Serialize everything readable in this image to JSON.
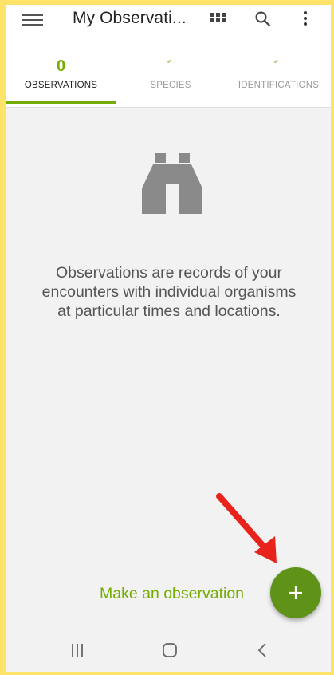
{
  "appbar": {
    "title": "My Observati...",
    "icons": [
      "menu-icon",
      "grid-view-icon",
      "search-icon",
      "more-vert-icon"
    ]
  },
  "tabs": [
    {
      "label": "OBSERVATIONS",
      "count": "0",
      "active": true
    },
    {
      "label": "SPECIES",
      "count": "",
      "active": false
    },
    {
      "label": "IDENTIFICATIONS",
      "count": "",
      "active": false
    }
  ],
  "empty_state": {
    "icon": "binoculars-icon",
    "message": "Observations are records of your encounters with individual organisms at particular times and locations."
  },
  "action": {
    "label": "Make an observation",
    "fab_icon": "plus-icon"
  },
  "colors": {
    "accent": "#74ac00",
    "fab": "#5f9317",
    "annotation_arrow": "#e8231c",
    "frame": "#fde36a"
  },
  "navbar": [
    "recent-apps-icon",
    "home-icon",
    "back-icon"
  ]
}
